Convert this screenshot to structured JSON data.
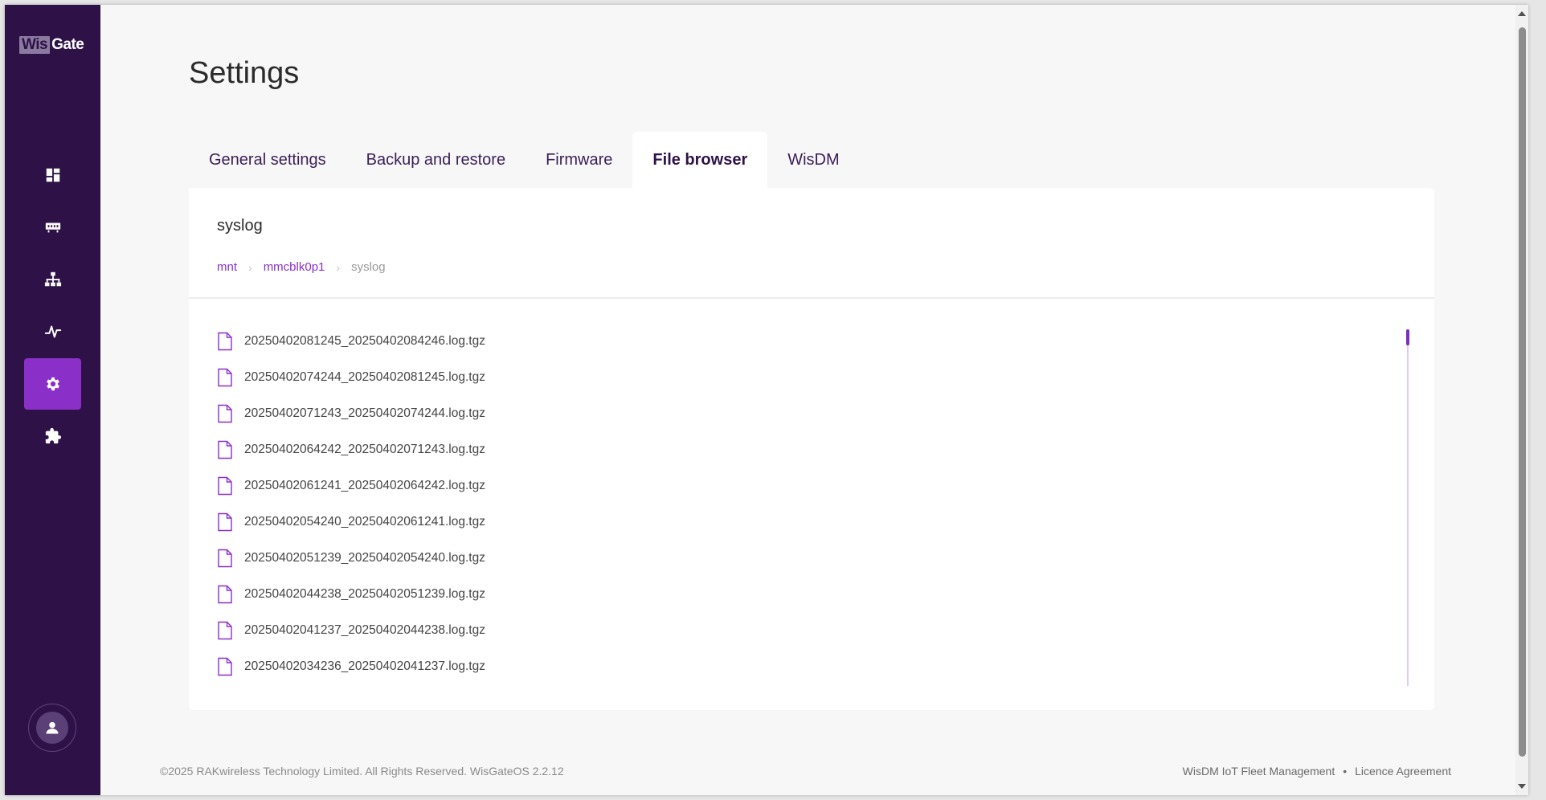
{
  "logo": {
    "part1": "Wis",
    "part2": "Gate"
  },
  "sidebar": {
    "items": [
      {
        "name": "dashboard",
        "icon": "dashboard-icon"
      },
      {
        "name": "gateway",
        "icon": "gateway-icon"
      },
      {
        "name": "network",
        "icon": "network-icon"
      },
      {
        "name": "monitoring",
        "icon": "activity-icon"
      },
      {
        "name": "settings",
        "icon": "gear-icon",
        "active": true
      },
      {
        "name": "extensions",
        "icon": "puzzle-icon"
      }
    ],
    "user_icon": "user-icon"
  },
  "page": {
    "title": "Settings"
  },
  "tabs": [
    {
      "label": "General settings"
    },
    {
      "label": "Backup and restore"
    },
    {
      "label": "Firmware"
    },
    {
      "label": "File browser",
      "active": true
    },
    {
      "label": "WisDM"
    }
  ],
  "file_browser": {
    "folder_title": "syslog",
    "breadcrumb": [
      "mnt",
      "mmcblk0p1",
      "syslog"
    ],
    "files": [
      "20250402081245_20250402084246.log.tgz",
      "20250402074244_20250402081245.log.tgz",
      "20250402071243_20250402074244.log.tgz",
      "20250402064242_20250402071243.log.tgz",
      "20250402061241_20250402064242.log.tgz",
      "20250402054240_20250402061241.log.tgz",
      "20250402051239_20250402054240.log.tgz",
      "20250402044238_20250402051239.log.tgz",
      "20250402041237_20250402044238.log.tgz",
      "20250402034236_20250402041237.log.tgz"
    ]
  },
  "footer": {
    "copyright": "©2025 RAKwireless Technology Limited. All Rights Reserved. WisGateOS 2.2.12",
    "link_fleet": "WisDM IoT Fleet Management",
    "separator": "•",
    "link_licence": "Licence Agreement"
  },
  "colors": {
    "sidebar_bg": "#2e1247",
    "accent": "#8b2fc9",
    "page_bg": "#f7f7f8"
  }
}
